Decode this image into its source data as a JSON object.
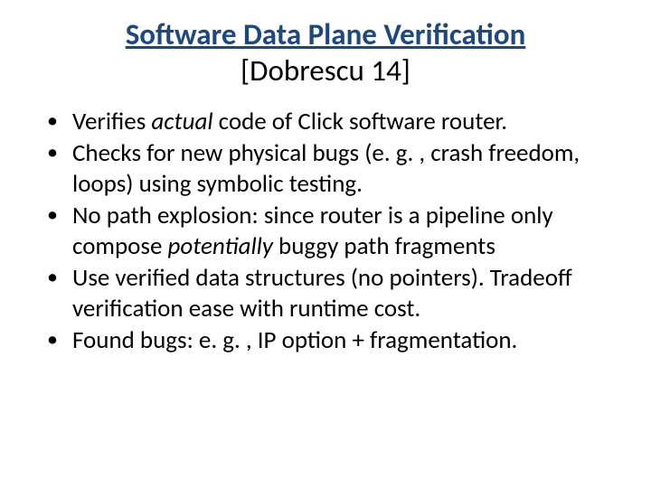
{
  "title": {
    "main": "Software Data Plane Verification",
    "sub": "[Dobrescu 14]"
  },
  "bullets": [
    {
      "pre": "Verifies ",
      "em": "actual",
      "post": " code of Click software router."
    },
    {
      "pre": "Checks for new physical bugs (e. g. , crash freedom, loops) using symbolic testing.",
      "em": "",
      "post": ""
    },
    {
      "pre": "No path explosion: since router is a pipeline only compose ",
      "em": "potentially",
      "post": " buggy path fragments"
    },
    {
      "pre": "Use verified data structures (no pointers). Tradeoff verification ease with runtime cost.",
      "em": "",
      "post": ""
    },
    {
      "pre": "Found bugs: e. g. , IP option  + fragmentation.",
      "em": "",
      "post": ""
    }
  ]
}
